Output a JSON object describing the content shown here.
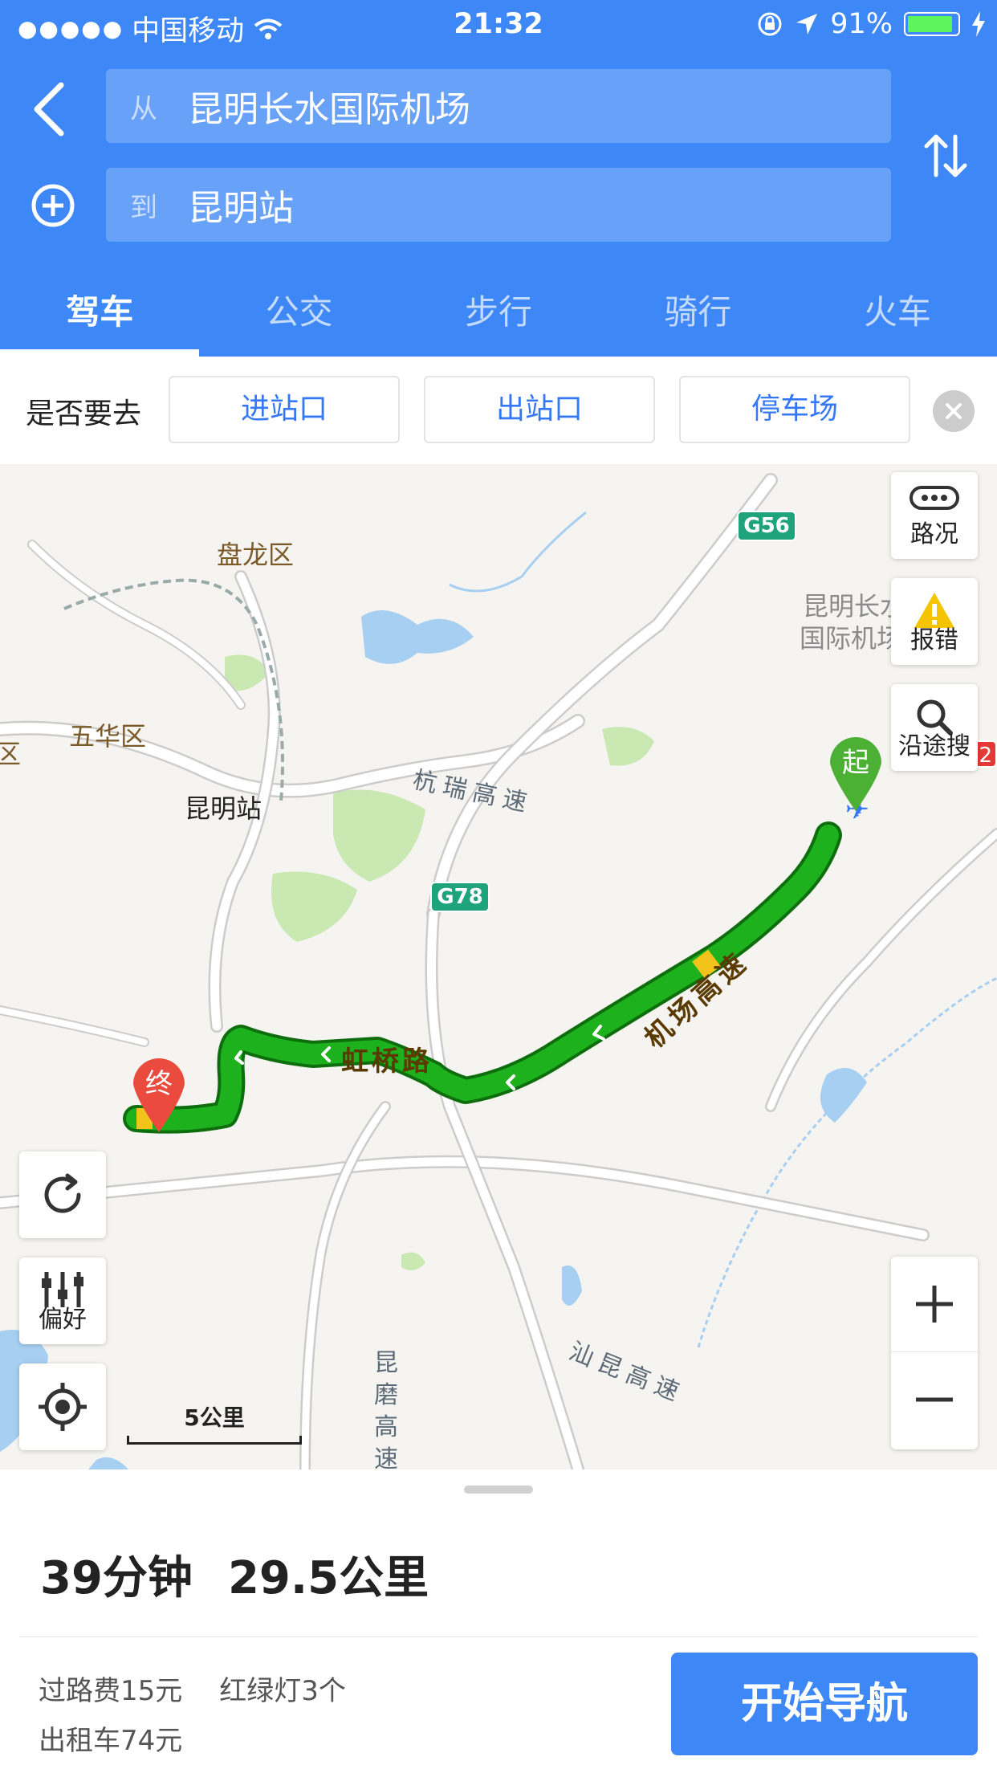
{
  "status_bar": {
    "carrier": "中国移动",
    "time": "21:32",
    "battery": "91%",
    "battery_level": 0.91
  },
  "route_input": {
    "from_prefix": "从",
    "from_value": "昆明长水国际机场",
    "to_prefix": "到",
    "to_value": "昆明站"
  },
  "tabs": [
    {
      "label": "驾车",
      "active": true
    },
    {
      "label": "公交",
      "active": false
    },
    {
      "label": "步行",
      "active": false
    },
    {
      "label": "骑行",
      "active": false
    },
    {
      "label": "火车",
      "active": false
    }
  ],
  "quick_destination": {
    "label": "是否要去",
    "options": [
      "进站口",
      "出站口",
      "停车场"
    ]
  },
  "map": {
    "controls": {
      "traffic": "路况",
      "report": "报错",
      "search_along": "沿途搜",
      "preference": "偏好"
    },
    "place_labels": {
      "panlong": "盘龙区",
      "wuhua": "五华区",
      "qu_edge": "区",
      "airport_line1": "昆明长水",
      "airport_line2": "国际机场",
      "station": "昆明站",
      "hangrui": "杭瑞高速",
      "shankun": "汕昆高速",
      "kunmo": "昆磨高速",
      "hongqiao": "虹桥路",
      "airport_expressway": "机场高速"
    },
    "shields": {
      "g56": "G56",
      "g78": "G78",
      "edge": "2"
    },
    "markers": {
      "start": "起",
      "end": "终"
    },
    "scale_label": "5公里"
  },
  "summary": {
    "duration": "39分钟",
    "distance": "29.5公里",
    "toll": "过路费15元",
    "traffic_lights": "红绿灯3个",
    "taxi": "出租车74元",
    "start_button": "开始导航"
  },
  "colors": {
    "brand_blue": "#3E87F6",
    "route_green": "#1DB11D",
    "route_yellow": "#F2C31B",
    "start_marker": "#4CB034",
    "end_marker": "#EB4B3F"
  }
}
